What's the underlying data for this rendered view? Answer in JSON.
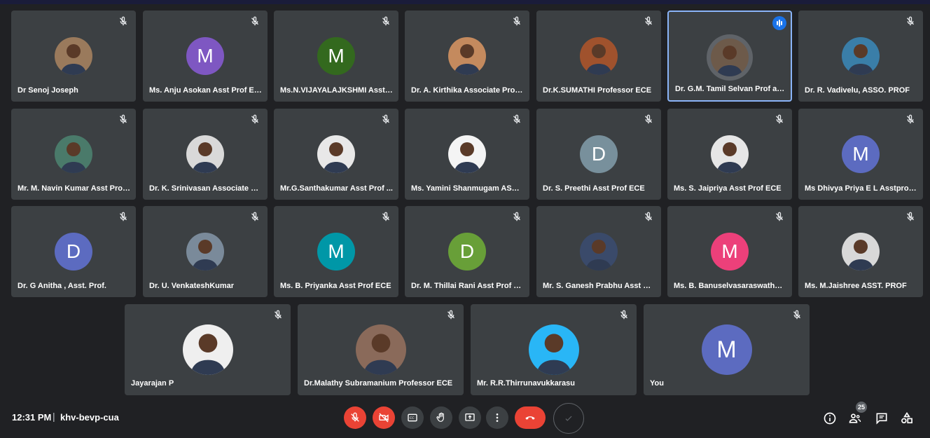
{
  "participants": [
    {
      "name": "Dr Senoj Joseph",
      "avatar": "photo",
      "color": "#9a7a5c"
    },
    {
      "name": "Ms. Anju Asokan Asst Prof ECE",
      "avatar": "letter",
      "letter": "M",
      "color": "#7e57c2"
    },
    {
      "name": "Ms.N.VIJAYALAJKSHMI Asst ...",
      "avatar": "letter",
      "letter": "M",
      "color": "#33691e"
    },
    {
      "name": "Dr. A. Kirthika Associate Prof....",
      "avatar": "photo",
      "color": "#c48a5e"
    },
    {
      "name": "Dr.K.SUMATHI Professor ECE",
      "avatar": "photo",
      "color": "#a0522d"
    },
    {
      "name": "Dr. G.M. Tamil Selvan Prof an...",
      "avatar": "photo",
      "color": "#6d5a4a"
    },
    {
      "name": "Dr. R. Vadivelu, ASSO. PROF",
      "avatar": "photo",
      "color": "#3a7ea8"
    },
    {
      "name": "Mr. M. Navin Kumar Asst Prof...",
      "avatar": "photo",
      "color": "#4a7a6a"
    },
    {
      "name": "Dr. K. Srinivasan Associate Pr...",
      "avatar": "photo",
      "color": "#d9d9d9"
    },
    {
      "name": "Mr.G.Santhakumar Asst Prof ...",
      "avatar": "photo",
      "color": "#e8e8e8"
    },
    {
      "name": "Ms. Yamini Shanmugam ASST...",
      "avatar": "photo",
      "color": "#f4f4f4"
    },
    {
      "name": "Dr. S. Preethi Asst Prof ECE",
      "avatar": "letter",
      "letter": "D",
      "color": "#78909c"
    },
    {
      "name": "Ms. S. Jaipriya Asst Prof ECE",
      "avatar": "photo",
      "color": "#e6e6e6"
    },
    {
      "name": "Ms Dhivya Priya E L Asstprof ...",
      "avatar": "letter",
      "letter": "M",
      "color": "#5c6bc0"
    },
    {
      "name": "Dr. G Anitha , Asst. Prof.",
      "avatar": "letter",
      "letter": "D",
      "color": "#5c6bc0"
    },
    {
      "name": "Dr. U. VenkateshKumar",
      "avatar": "photo",
      "color": "#7a8a9a"
    },
    {
      "name": "Ms. B. Priyanka Asst Prof ECE",
      "avatar": "letter",
      "letter": "M",
      "color": "#0097a7"
    },
    {
      "name": "Dr. M. Thillai Rani Asst Prof E...",
      "avatar": "letter",
      "letter": "D",
      "color": "#689f38"
    },
    {
      "name": "Mr. S. Ganesh Prabhu Asst Pr...",
      "avatar": "photo",
      "color": "#3a4a6a"
    },
    {
      "name": "Ms. B. Banuselvasaraswathy ...",
      "avatar": "letter",
      "letter": "M",
      "color": "#ec407a"
    },
    {
      "name": "Ms. M.Jaishree ASST. PROF",
      "avatar": "photo",
      "color": "#d8d8d8"
    },
    {
      "name": "Jayarajan P",
      "avatar": "photo",
      "color": "#efefef"
    },
    {
      "name": "Dr.Malathy Subramanium Professor ECE",
      "avatar": "photo",
      "color": "#8a6a5a"
    },
    {
      "name": "Mr. R.R.Thirrunavukkarasu",
      "avatar": "photo",
      "color": "#29b6f6"
    },
    {
      "name": "You",
      "avatar": "letter",
      "letter": "M",
      "color": "#5c6bc0"
    }
  ],
  "meeting": {
    "time": "12:31 PM",
    "separator": "|",
    "code": "khv-bevp-cua"
  },
  "controls": [
    {
      "icon": "mic-off-icon",
      "label": "Turn on microphone"
    },
    {
      "icon": "camera-off-icon",
      "label": "Turn on camera"
    },
    {
      "icon": "captions-icon",
      "label": "Turn on captions"
    },
    {
      "icon": "raise-hand-icon",
      "label": "Raise hand"
    },
    {
      "icon": "present-icon",
      "label": "Present now"
    },
    {
      "icon": "more-options-icon",
      "label": "More options"
    },
    {
      "icon": "leave-call-icon",
      "label": "Leave call"
    }
  ],
  "right": {
    "participant_count": "25"
  },
  "colors": {
    "background": "#202124",
    "tile": "#3c4043",
    "accent": "#8ab4f8",
    "danger": "#ea4335"
  }
}
